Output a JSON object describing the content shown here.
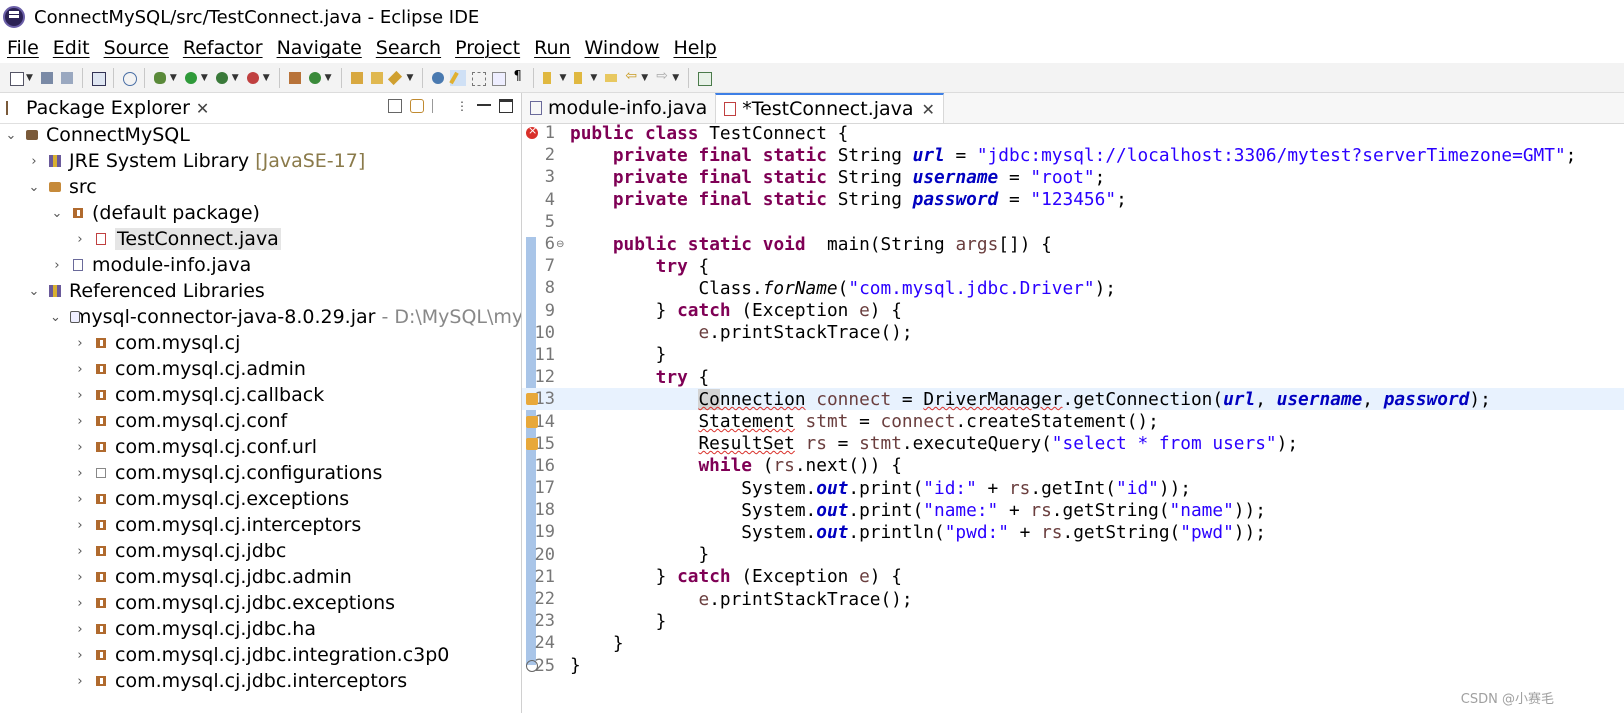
{
  "window": {
    "title": "ConnectMySQL/src/TestConnect.java - Eclipse IDE"
  },
  "menu": [
    "File",
    "Edit",
    "Source",
    "Refactor",
    "Navigate",
    "Search",
    "Project",
    "Run",
    "Window",
    "Help"
  ],
  "package_explorer": {
    "tab_label": "Package Explorer",
    "tree": [
      {
        "label": "ConnectMySQL",
        "decor": "",
        "indent": 0,
        "chev": "⌄",
        "icon": "project-icon"
      },
      {
        "label": "JRE System Library",
        "decor": "[JavaSE-17]",
        "indent": 1,
        "chev": "›",
        "icon": "library-icon"
      },
      {
        "label": "src",
        "decor": "",
        "indent": 1,
        "chev": "⌄",
        "icon": "source-folder-icon"
      },
      {
        "label": "(default package)",
        "decor": "",
        "indent": 2,
        "chev": "⌄",
        "icon": "package-icon"
      },
      {
        "label": "TestConnect.java",
        "decor": "",
        "indent": 3,
        "chev": "›",
        "icon": "java-file-error-icon",
        "selected": true
      },
      {
        "label": "module-info.java",
        "decor": "",
        "indent": 2,
        "chev": "›",
        "icon": "java-file-icon"
      },
      {
        "label": "Referenced Libraries",
        "decor": "",
        "indent": 1,
        "chev": "⌄",
        "icon": "library-icon"
      },
      {
        "label": "mysql-connector-java-8.0.29.jar",
        "decor": "- D:\\MySQL\\mysql-",
        "indent": 2,
        "chev": "⌄",
        "icon": "jar-icon"
      },
      {
        "label": "com.mysql.cj",
        "decor": "",
        "indent": 3,
        "chev": "›",
        "icon": "package-icon"
      },
      {
        "label": "com.mysql.cj.admin",
        "decor": "",
        "indent": 3,
        "chev": "›",
        "icon": "package-icon"
      },
      {
        "label": "com.mysql.cj.callback",
        "decor": "",
        "indent": 3,
        "chev": "›",
        "icon": "package-icon"
      },
      {
        "label": "com.mysql.cj.conf",
        "decor": "",
        "indent": 3,
        "chev": "›",
        "icon": "package-icon"
      },
      {
        "label": "com.mysql.cj.conf.url",
        "decor": "",
        "indent": 3,
        "chev": "›",
        "icon": "package-icon"
      },
      {
        "label": "com.mysql.cj.configurations",
        "decor": "",
        "indent": 3,
        "chev": "›",
        "icon": "empty-package-icon"
      },
      {
        "label": "com.mysql.cj.exceptions",
        "decor": "",
        "indent": 3,
        "chev": "›",
        "icon": "package-icon"
      },
      {
        "label": "com.mysql.cj.interceptors",
        "decor": "",
        "indent": 3,
        "chev": "›",
        "icon": "package-icon"
      },
      {
        "label": "com.mysql.cj.jdbc",
        "decor": "",
        "indent": 3,
        "chev": "›",
        "icon": "package-icon"
      },
      {
        "label": "com.mysql.cj.jdbc.admin",
        "decor": "",
        "indent": 3,
        "chev": "›",
        "icon": "package-icon"
      },
      {
        "label": "com.mysql.cj.jdbc.exceptions",
        "decor": "",
        "indent": 3,
        "chev": "›",
        "icon": "package-icon"
      },
      {
        "label": "com.mysql.cj.jdbc.ha",
        "decor": "",
        "indent": 3,
        "chev": "›",
        "icon": "package-icon"
      },
      {
        "label": "com.mysql.cj.jdbc.integration.c3p0",
        "decor": "",
        "indent": 3,
        "chev": "›",
        "icon": "package-icon"
      },
      {
        "label": "com.mysql.cj.jdbc.interceptors",
        "decor": "",
        "indent": 3,
        "chev": "›",
        "icon": "package-icon"
      }
    ]
  },
  "editor": {
    "tabs": [
      {
        "label": "module-info.java",
        "active": false
      },
      {
        "label": "*TestConnect.java",
        "active": true
      }
    ],
    "lines": [
      {
        "n": "1",
        "marker": "error"
      },
      {
        "n": "2"
      },
      {
        "n": "3"
      },
      {
        "n": "4"
      },
      {
        "n": "5"
      },
      {
        "n": "6",
        "fold": true
      },
      {
        "n": "7"
      },
      {
        "n": "8"
      },
      {
        "n": "9"
      },
      {
        "n": "10"
      },
      {
        "n": "11"
      },
      {
        "n": "12"
      },
      {
        "n": "13",
        "marker": "warn",
        "current": true
      },
      {
        "n": "14",
        "marker": "warn"
      },
      {
        "n": "15",
        "marker": "warn"
      },
      {
        "n": "16"
      },
      {
        "n": "17"
      },
      {
        "n": "18"
      },
      {
        "n": "19"
      },
      {
        "n": "20"
      },
      {
        "n": "21"
      },
      {
        "n": "22"
      },
      {
        "n": "23"
      },
      {
        "n": "24"
      },
      {
        "n": "25",
        "marker": "end"
      }
    ],
    "code": {
      "l1": [
        "public",
        "class",
        "TestConnect {"
      ],
      "l2": [
        "private",
        "final",
        "static",
        "String ",
        "url",
        " = ",
        "\"jdbc:mysql://localhost:3306/mytest?serverTimezone=GMT\"",
        ";"
      ],
      "l3": [
        "private",
        "final",
        "static",
        "String ",
        "username",
        " = ",
        "\"root\"",
        ";"
      ],
      "l4": [
        "private",
        "final",
        "static",
        "String ",
        "password",
        " = ",
        "\"123456\"",
        ";"
      ],
      "l6": [
        "public",
        "static",
        "void",
        " main(String ",
        "args",
        "[]) {"
      ],
      "l7": [
        "try",
        " {"
      ],
      "l8": [
        "Class.",
        "forName",
        "(",
        "\"com.mysql.jdbc.Driver\"",
        ");"
      ],
      "l9": [
        "} ",
        "catch",
        " (Exception ",
        "e",
        ") {"
      ],
      "l10": [
        "e",
        ".printStackTrace();"
      ],
      "l11": [
        "}"
      ],
      "l12": [
        "try",
        " {"
      ],
      "l13": [
        "Co",
        "nnection",
        " ",
        "connect",
        " = ",
        "DriverManager",
        ".getConnection(",
        "url",
        ", ",
        "username",
        ", ",
        "password",
        ");"
      ],
      "l14": [
        "Statement",
        " ",
        "stmt",
        " = ",
        "connect",
        ".createStatement();"
      ],
      "l15": [
        "ResultSet",
        " ",
        "rs",
        " = ",
        "stmt",
        ".executeQuery(",
        "\"select * from users\"",
        ");"
      ],
      "l16": [
        "while",
        " (",
        "rs",
        ".next()) {"
      ],
      "l17": [
        "System.",
        "out",
        ".print(",
        "\"id:\"",
        " + ",
        "rs",
        ".getInt(",
        "\"id\"",
        "));"
      ],
      "l18": [
        "System.",
        "out",
        ".print(",
        "\"name:\"",
        " + ",
        "rs",
        ".getString(",
        "\"name\"",
        "));"
      ],
      "l19": [
        "System.",
        "out",
        ".println(",
        "\"pwd:\"",
        " + ",
        "rs",
        ".getString(",
        "\"pwd\"",
        "));"
      ],
      "l20": [
        "}"
      ],
      "l21": [
        "} ",
        "catch",
        " (Exception ",
        "e",
        ") {"
      ],
      "l22": [
        "e",
        ".printStackTrace();"
      ],
      "l23": [
        "}"
      ],
      "l24": [
        "}"
      ],
      "l25": [
        "}"
      ]
    }
  },
  "watermark": "CSDN @小赛毛",
  "colors": {
    "keyword": "#7f0055",
    "string": "#2a00ff",
    "field": "#0000c0",
    "local": "#6a3e3e",
    "error": "#d9302a",
    "current_line": "#e8f2fe"
  }
}
